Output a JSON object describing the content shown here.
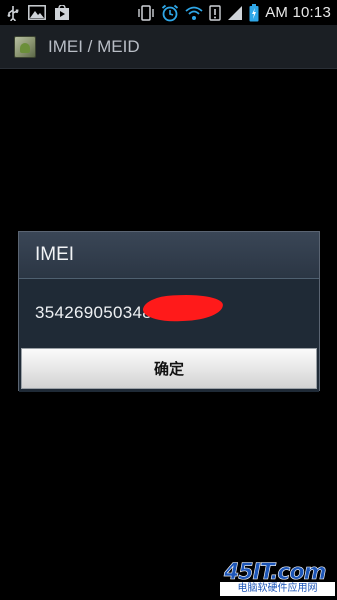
{
  "status_bar": {
    "time": "AM 10:13",
    "icons": [
      "usb-icon",
      "gallery-icon",
      "play-store-icon",
      "vibrate-icon",
      "alarm-icon",
      "wifi-icon",
      "no-sim-icon",
      "signal-icon",
      "battery-charging-icon"
    ]
  },
  "action_bar": {
    "title": "IMEI / MEID"
  },
  "dialog": {
    "title": "IMEI",
    "value": "354269050348",
    "ok_label": "确定"
  },
  "watermark": {
    "logo": "45IT.com",
    "subtitle": "电脑软硬件应用网"
  },
  "colors": {
    "background": "#000000",
    "dialog_title_bg": "#34404f",
    "dialog_body_bg": "#1f2a36",
    "redaction": "#ff1a1a",
    "watermark_blue": "#1d56b8"
  }
}
